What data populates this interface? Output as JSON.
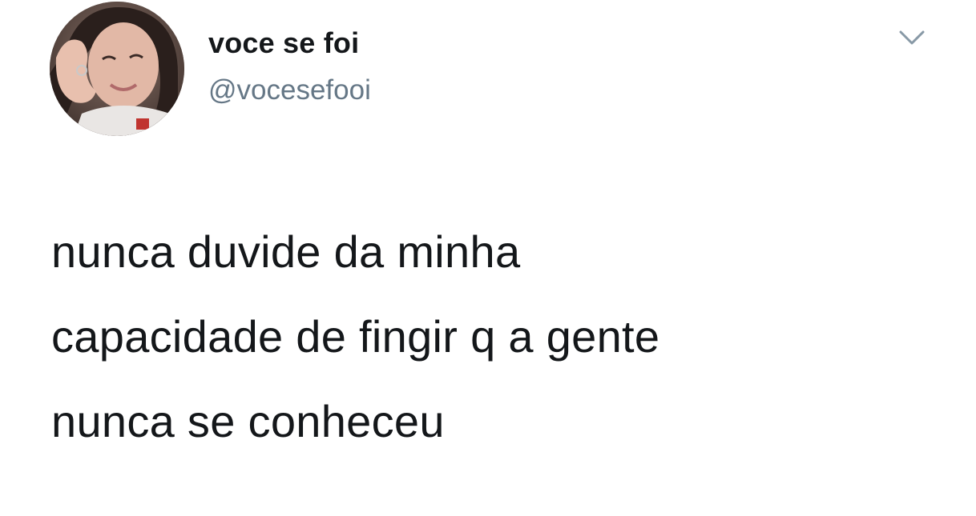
{
  "tweet": {
    "display_name": "voce se foi",
    "handle": "@vocesefooi",
    "text_lines": [
      "nunca duvide da minha",
      "capacidade de fingir q a gente",
      "nunca se conheceu"
    ]
  },
  "icons": {
    "avatar": "profile-photo",
    "menu": "chevron-down-icon"
  },
  "colors": {
    "text": "#14171a",
    "secondary_text": "#657786",
    "chevron": "#8899a6",
    "background": "#ffffff"
  }
}
